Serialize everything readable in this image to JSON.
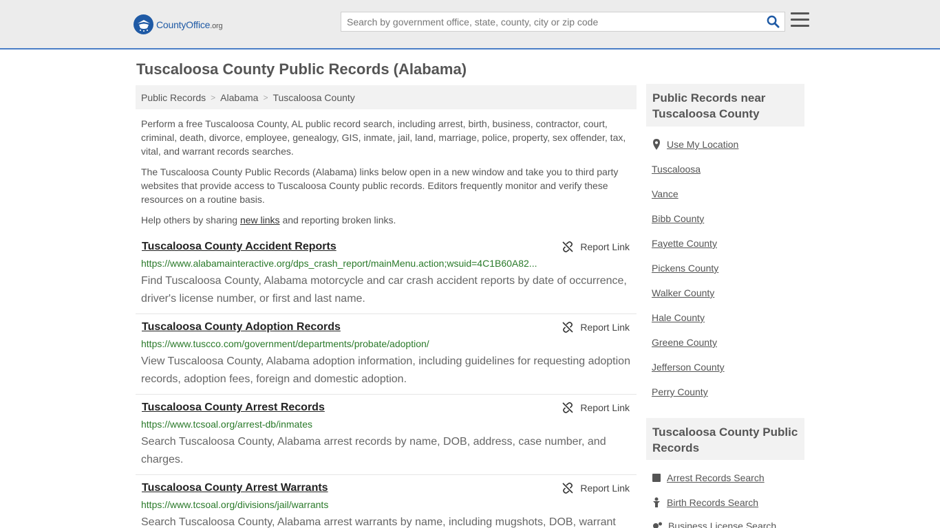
{
  "header": {
    "logo_text_main": "CountyOffice",
    "logo_text_org": ".org",
    "search_placeholder": "Search by government office, state, county, city or zip code"
  },
  "page": {
    "title": "Tuscaloosa County Public Records (Alabama)"
  },
  "breadcrumb": [
    "Public Records",
    "Alabama",
    "Tuscaloosa County"
  ],
  "intro": {
    "p1": "Perform a free Tuscaloosa County, AL public record search, including arrest, birth, business, contractor, court, criminal, death, divorce, employee, genealogy, GIS, inmate, jail, land, marriage, police, property, sex offender, tax, vital, and warrant records searches.",
    "p2": "The Tuscaloosa County Public Records (Alabama) links below open in a new window and take you to third party websites that provide access to Tuscaloosa County public records. Editors frequently monitor and verify these resources on a routine basis.",
    "p3_before": "Help others by sharing ",
    "p3_link": "new links",
    "p3_after": " and reporting broken links."
  },
  "report_label": "Report Link",
  "records": [
    {
      "title": "Tuscaloosa County Accident Reports",
      "url": "https://www.alabamainteractive.org/dps_crash_report/mainMenu.action;wsuid=4C1B60A82...",
      "desc": "Find Tuscaloosa County, Alabama motorcycle and car crash accident reports by date of occurrence, driver's license number, or first and last name."
    },
    {
      "title": "Tuscaloosa County Adoption Records",
      "url": "https://www.tuscco.com/government/departments/probate/adoption/",
      "desc": "View Tuscaloosa County, Alabama adoption information, including guidelines for requesting adoption records, adoption fees, foreign and domestic adoption."
    },
    {
      "title": "Tuscaloosa County Arrest Records",
      "url": "https://www.tcsoal.org/arrest-db/inmates",
      "desc": "Search Tuscaloosa County, Alabama arrest records by name, DOB, address, case number, and charges."
    },
    {
      "title": "Tuscaloosa County Arrest Warrants",
      "url": "https://www.tcsoal.org/divisions/jail/warrants",
      "desc": "Search Tuscaloosa County, Alabama arrest warrants by name, including mugshots, DOB, warrant"
    }
  ],
  "sidebar": {
    "nearby_heading": "Public Records near Tuscaloosa County",
    "use_location": "Use My Location",
    "nearby": [
      "Tuscaloosa",
      "Vance",
      "Bibb County",
      "Fayette County",
      "Pickens County",
      "Walker County",
      "Hale County",
      "Greene County",
      "Jefferson County",
      "Perry County"
    ],
    "records_heading": "Tuscaloosa County Public Records",
    "records_links": [
      "Arrest Records Search",
      "Birth Records Search",
      "Business License Search"
    ]
  }
}
